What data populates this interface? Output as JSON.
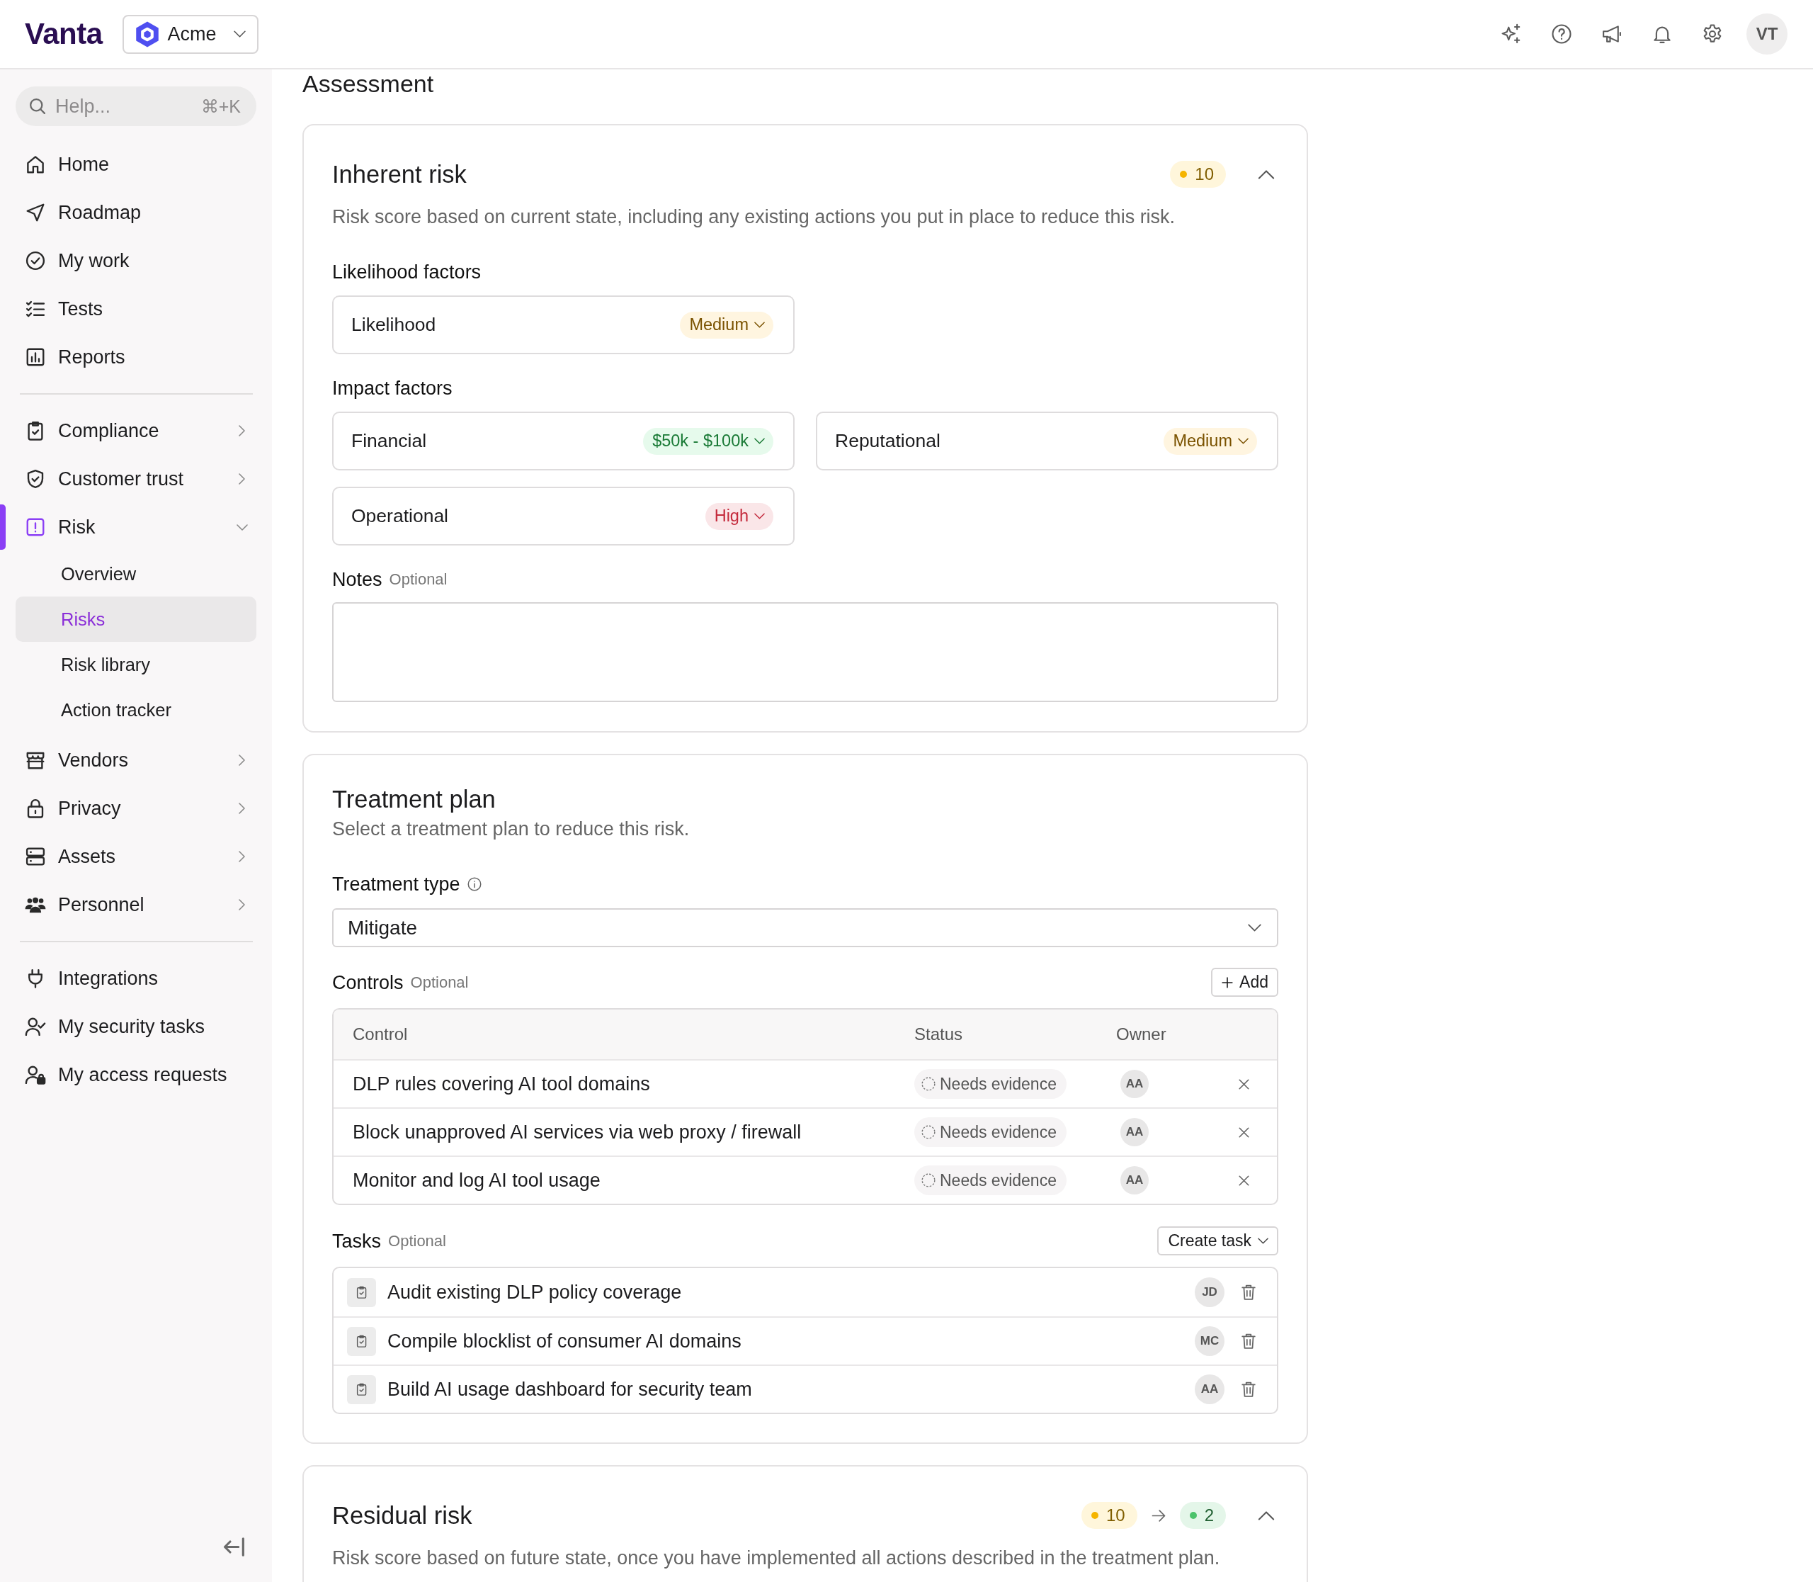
{
  "top_bar": {
    "logo": "Vanta",
    "workspace": "Acme",
    "avatar": "VT"
  },
  "sidebar": {
    "search": {
      "placeholder": "Help...",
      "shortcut": "⌘+K"
    },
    "sections": [
      {
        "items": [
          {
            "label": "Home",
            "selected": false
          },
          {
            "label": "Roadmap",
            "selected": false
          },
          {
            "label": "My work",
            "selected": false
          },
          {
            "label": "Tests",
            "selected": false
          },
          {
            "label": "Reports",
            "selected": false
          }
        ]
      },
      {
        "items": [
          {
            "label": "Compliance",
            "selected": false,
            "expanded": false
          },
          {
            "label": "Customer trust",
            "selected": false,
            "expanded": false
          },
          {
            "label": "Risk",
            "selected": true,
            "expanded": true,
            "children": [
              {
                "label": "Overview",
                "selected": false
              },
              {
                "label": "Risks",
                "selected": true
              },
              {
                "label": "Risk library",
                "selected": false
              },
              {
                "label": "Action tracker",
                "selected": false
              }
            ]
          },
          {
            "label": "Vendors",
            "selected": false,
            "expanded": false
          },
          {
            "label": "Privacy",
            "selected": false,
            "expanded": false
          },
          {
            "label": "Assets",
            "selected": false,
            "expanded": false
          },
          {
            "label": "Personnel",
            "selected": false,
            "expanded": false
          }
        ]
      },
      {
        "items": [
          {
            "label": "Integrations",
            "selected": false
          },
          {
            "label": "My security tasks",
            "selected": false
          },
          {
            "label": "My access requests",
            "selected": false
          }
        ]
      }
    ]
  },
  "main": {
    "heading": "Assessment",
    "inherent_risk": {
      "title": "Inherent risk",
      "score": {
        "value": "10",
        "color": "#f5b400"
      },
      "expanded": true,
      "description": "Risk score based on current state, including any existing actions you put in place to reduce this risk.",
      "likelihood": {
        "heading": "Likelihood factors",
        "factors": [
          {
            "label": "Likelihood",
            "value": "Medium",
            "color": "#7a5200"
          }
        ]
      },
      "impact": {
        "heading": "Impact factors",
        "factors": [
          {
            "label": "Financial",
            "value": "$50k - $100k",
            "color": "#1a7a36"
          },
          {
            "label": "Reputational",
            "value": "Medium",
            "color": "#7a5200"
          },
          {
            "label": "Operational",
            "value": "High",
            "color": "#c42a3c"
          }
        ]
      },
      "notes": {
        "label": "Notes",
        "hint": "Optional"
      }
    },
    "treatment_plan": {
      "title": "Treatment plan",
      "description": "Select a treatment plan to reduce this risk.",
      "treatment_type": {
        "label": "Treatment type",
        "value": "Mitigate"
      },
      "controls": {
        "label": "Controls",
        "hint": "Optional",
        "add_button": "Add",
        "columns": [
          "Control",
          "Status",
          "Owner"
        ],
        "rows": [
          {
            "control": "DLP rules covering AI tool domains",
            "status": "Needs evidence",
            "owner": "AA"
          },
          {
            "control": "Block unapproved AI services via web proxy / firewall",
            "status": "Needs evidence",
            "owner": "AA"
          },
          {
            "control": "Monitor and log AI tool usage",
            "status": "Needs evidence",
            "owner": "AA"
          }
        ]
      },
      "tasks": {
        "label": "Tasks",
        "hint": "Optional",
        "create_button": "Create task",
        "rows": [
          {
            "title": "Audit existing DLP policy coverage",
            "assignee": "JD"
          },
          {
            "title": "Compile blocklist of consumer AI domains",
            "assignee": "MC"
          },
          {
            "title": "Build AI usage dashboard for security team",
            "assignee": "AA"
          }
        ]
      }
    },
    "residual_risk": {
      "title": "Residual risk",
      "expanded": true,
      "score_from": {
        "value": "10",
        "color": "#f5b400"
      },
      "score_to": {
        "value": "2",
        "color": "#4cc36b"
      },
      "description": "Risk score based on future state, once you have implemented all actions described in the treatment plan."
    }
  }
}
